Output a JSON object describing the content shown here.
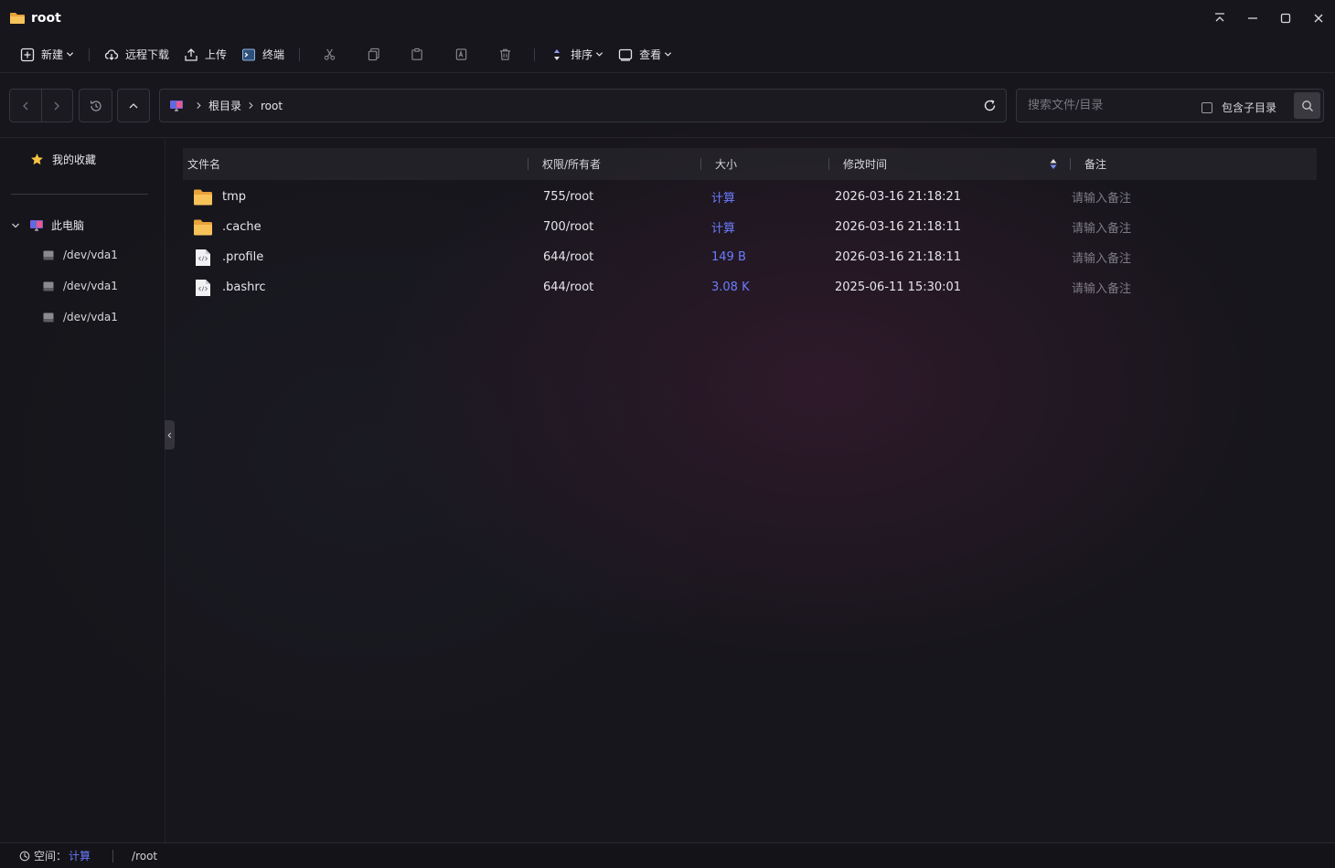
{
  "window": {
    "title": "root"
  },
  "toolbar": {
    "new_label": "新建",
    "remote_download_label": "远程下载",
    "upload_label": "上传",
    "terminal_label": "终端",
    "sort_label": "排序",
    "view_label": "查看"
  },
  "nav": {
    "breadcrumb": [
      "根目录",
      "root"
    ],
    "search_placeholder": "搜索文件/目录",
    "include_subdirs_label": "包含子目录"
  },
  "sidebar": {
    "favorites_label": "我的收藏",
    "this_pc_label": "此电脑",
    "disks": [
      "/dev/vda1",
      "/dev/vda1",
      "/dev/vda1"
    ]
  },
  "columns": {
    "name": "文件名",
    "perm": "权限/所有者",
    "size": "大小",
    "mtime": "修改时间",
    "note": "备注"
  },
  "files": [
    {
      "name": "tmp",
      "type": "folder",
      "perm": "755/root",
      "size": "计算",
      "mtime": "2026-03-16 21:18:21",
      "note_placeholder": "请输入备注"
    },
    {
      "name": ".cache",
      "type": "folder",
      "perm": "700/root",
      "size": "计算",
      "mtime": "2026-03-16 21:18:11",
      "note_placeholder": "请输入备注"
    },
    {
      "name": ".profile",
      "type": "file",
      "perm": "644/root",
      "size": "149 B",
      "mtime": "2026-03-16 21:18:11",
      "note_placeholder": "请输入备注"
    },
    {
      "name": ".bashrc",
      "type": "file",
      "perm": "644/root",
      "size": "3.08 K",
      "mtime": "2025-06-11 15:30:01",
      "note_placeholder": "请输入备注"
    }
  ],
  "status": {
    "space_label": "空间：",
    "space_value": "计算",
    "path": "/root"
  },
  "colors": {
    "accent": "#6b7cff",
    "folder": "#f5b642"
  }
}
